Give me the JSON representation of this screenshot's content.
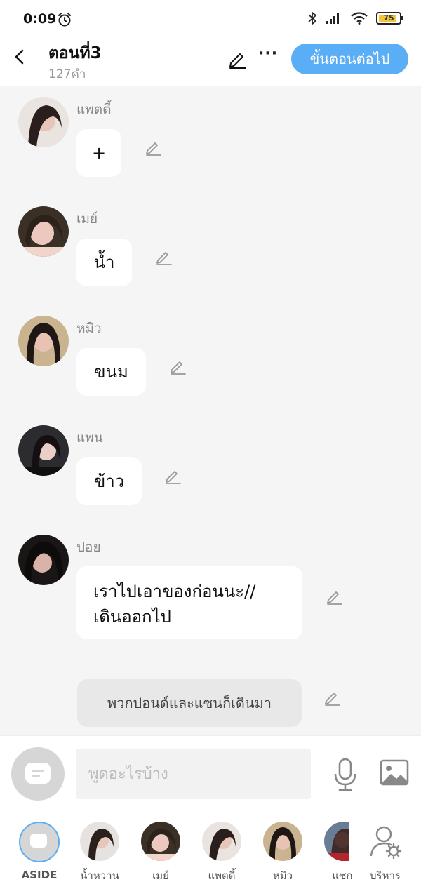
{
  "status": {
    "time": "0:09",
    "battery": "75"
  },
  "header": {
    "title": "ตอนที่3",
    "word_count": "127คำ",
    "next_label": "ขั้นตอนต่อไป"
  },
  "messages": [
    {
      "name": "แพตตี้",
      "text": "+"
    },
    {
      "name": "เมย์",
      "text": "น้ำ"
    },
    {
      "name": "หมิว",
      "text": "ขนม"
    },
    {
      "name": "แพน",
      "text": "ข้าว"
    },
    {
      "name": "ปอย",
      "text_line1": "เราไปเอาของก่อนนะ//",
      "text_line2": "เดินออกไป"
    }
  ],
  "narration": "พวกปอนด์และแซนก็เดินมา",
  "input": {
    "placeholder": "พูดอะไรบ้าง"
  },
  "characters": [
    {
      "label": "ASIDE"
    },
    {
      "label": "น้ำหวาน"
    },
    {
      "label": "เมย์"
    },
    {
      "label": "แพตตี้"
    },
    {
      "label": "หมิว"
    },
    {
      "label": "แซก"
    },
    {
      "label": "บริหาร"
    }
  ],
  "colors": {
    "accent": "#59aef5",
    "battery": "#f2c53d"
  }
}
